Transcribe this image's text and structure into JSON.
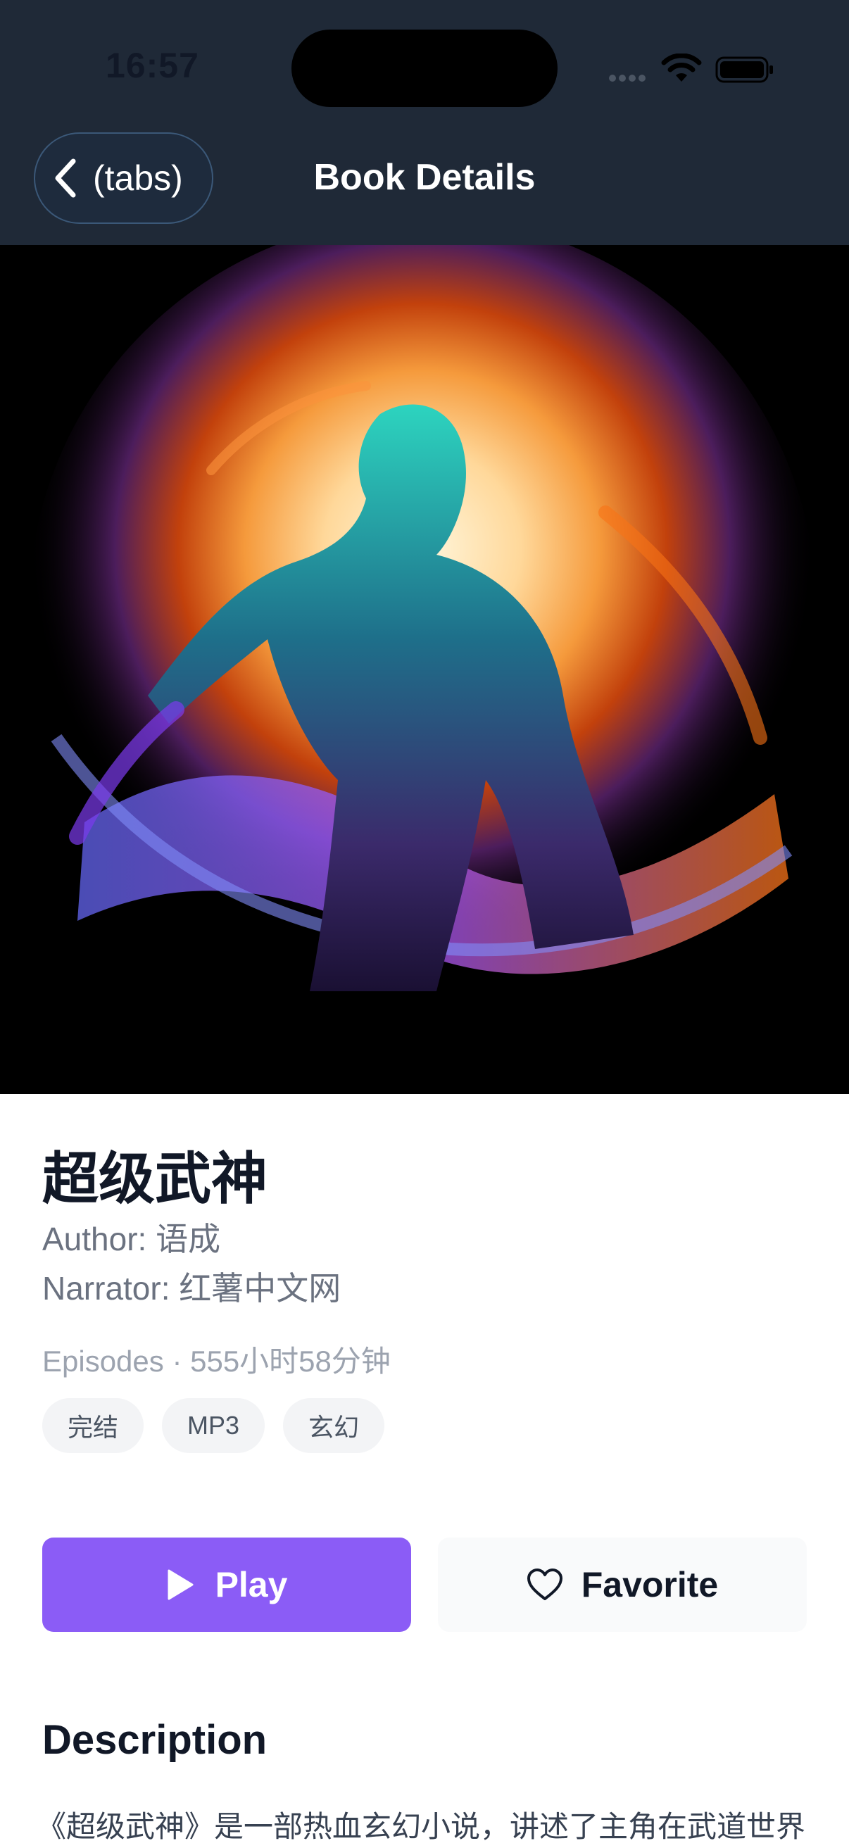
{
  "status_bar": {
    "time": "16:57"
  },
  "nav": {
    "back_label": "(tabs)",
    "title": "Book Details"
  },
  "book": {
    "title": "超级武神",
    "author": "Author: 语成",
    "narrator": "Narrator: 红薯中文网",
    "episodes": "Episodes · 555小时58分钟",
    "tags": [
      "完结",
      "MP3",
      "玄幻"
    ]
  },
  "actions": {
    "play_label": "Play",
    "favorite_label": "Favorite"
  },
  "description": {
    "title": "Description",
    "text": "《超级武神》是一部热血玄幻小说，讲述了主角在武道世界"
  },
  "colors": {
    "header_bg": "#1f2937",
    "accent": "#8b5cf6",
    "title_text": "#111827",
    "muted_text": "#6b7280"
  },
  "icons": [
    "back-chevron",
    "wifi",
    "battery",
    "play",
    "heart"
  ]
}
